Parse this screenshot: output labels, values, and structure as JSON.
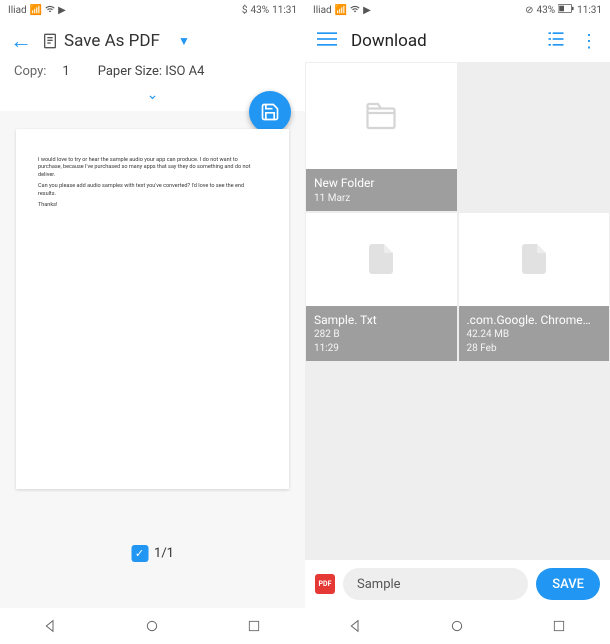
{
  "left": {
    "statusbar": {
      "carrier": "Iliad",
      "battery": "43%",
      "time": "11:31",
      "battery_prefix": "$"
    },
    "appbar": {
      "title": "Save As PDF"
    },
    "options": {
      "copy_label": "Copy:",
      "copy_value": "1",
      "paper_size": "Paper Size: ISO A4",
      "expand_icon": "⌄"
    },
    "preview": {
      "line1": "I would love to try or hear the sample audio your app can produce. I do not want to",
      "line2": "purchase, because I've purchased so many apps that say they do something and do not",
      "line3": "deliver.",
      "line4": "Can you please add audio samples with text you've converted? I'd love to see the end",
      "line5": "results.",
      "line6": "Thanks!"
    },
    "page_counter": "1/1"
  },
  "right": {
    "statusbar": {
      "carrier": "Iliad",
      "battery": "43%",
      "time": "11:31"
    },
    "appbar": {
      "title": "Download"
    },
    "files": [
      {
        "name": "New Folder",
        "meta1": "11 Marz",
        "meta2": "",
        "type": "folder"
      },
      {
        "name": "Sample. Txt",
        "meta1": "282 B",
        "meta2": "11:29",
        "type": "file"
      },
      {
        "name": ".com.Google. Chrome…",
        "meta1": "42.24 MB",
        "meta2": "28 Feb",
        "type": "file"
      }
    ],
    "savebar": {
      "filename": "Sample",
      "save_label": "SAVE"
    }
  }
}
